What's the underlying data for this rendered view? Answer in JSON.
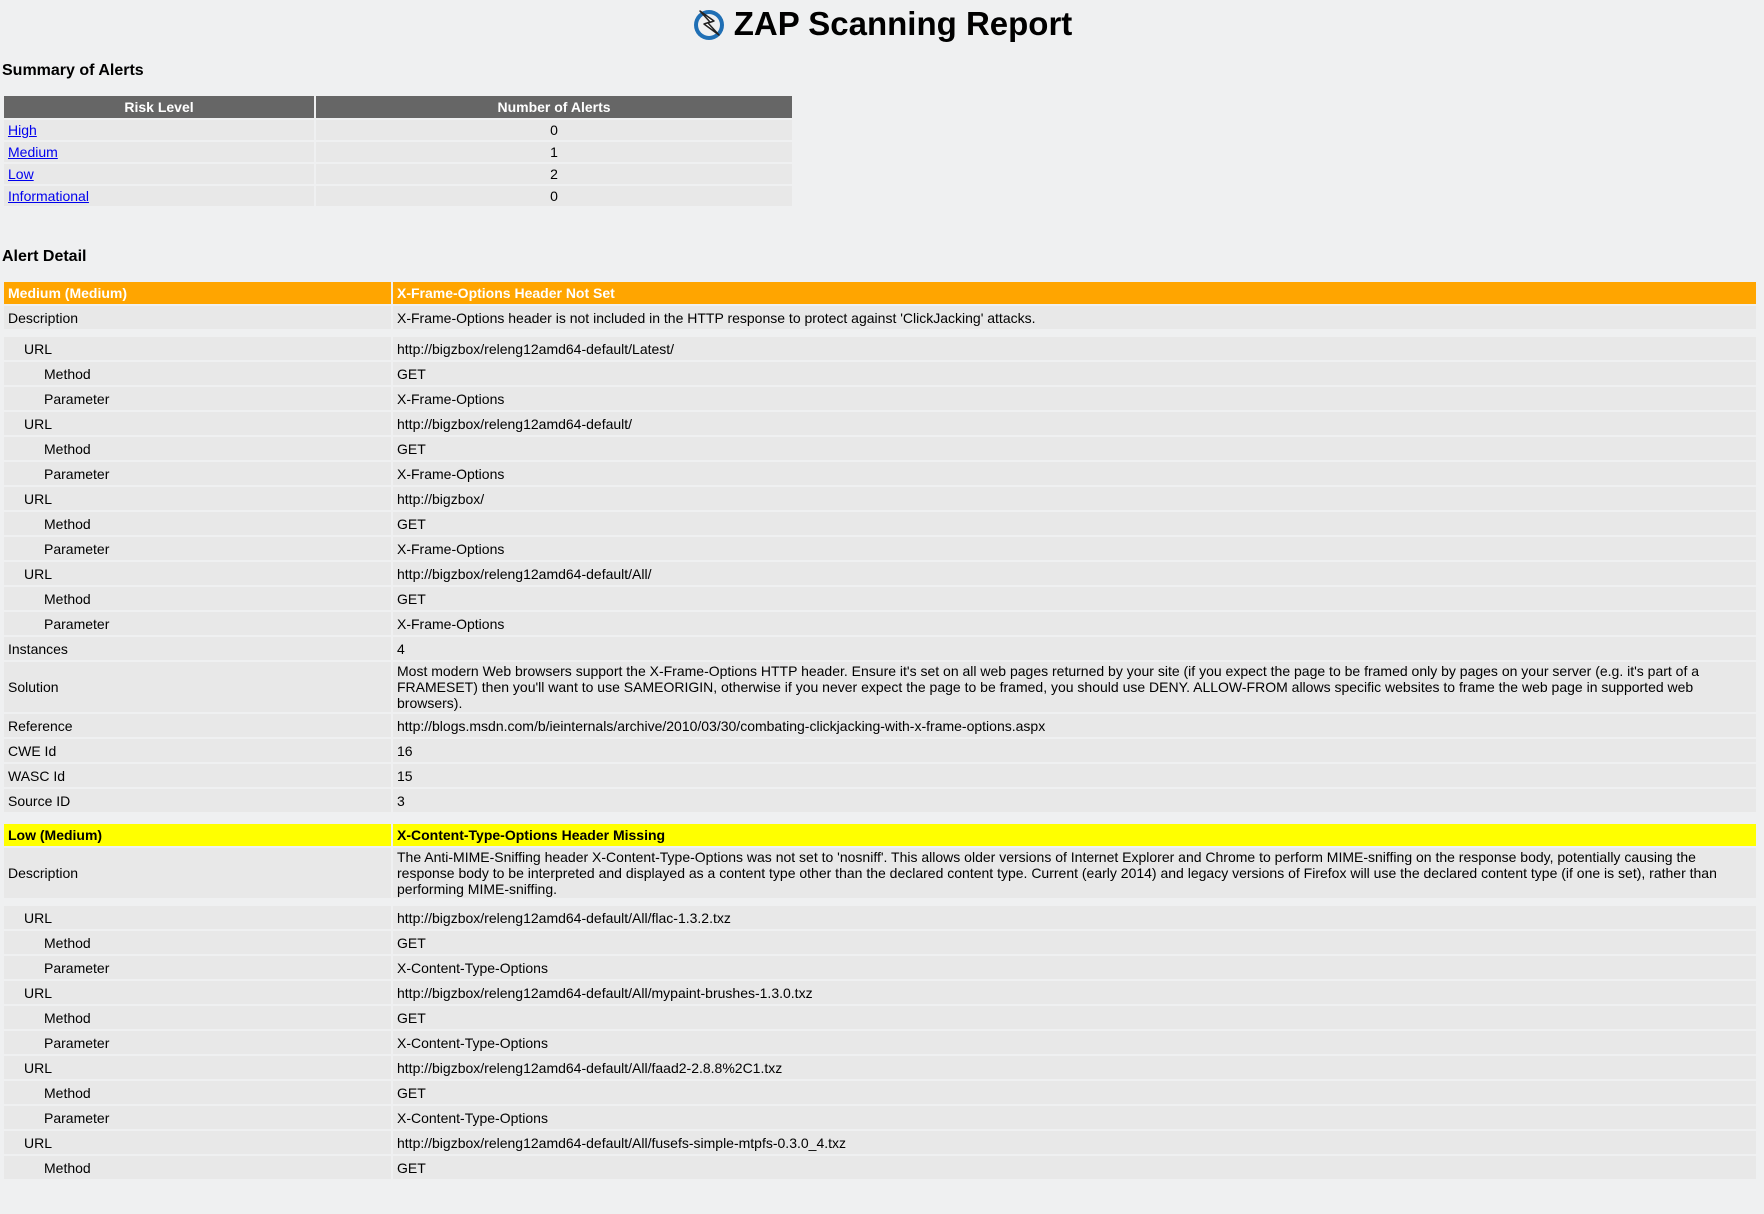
{
  "title": "ZAP Scanning Report",
  "summary": {
    "heading": "Summary of Alerts",
    "col_risk": "Risk Level",
    "col_count": "Number of Alerts",
    "rows": [
      {
        "level": "High",
        "count": "0"
      },
      {
        "level": "Medium",
        "count": "1"
      },
      {
        "level": "Low",
        "count": "2"
      },
      {
        "level": "Informational",
        "count": "0"
      }
    ]
  },
  "detail": {
    "heading": "Alert Detail",
    "alerts": [
      {
        "risk": "Medium (Medium)",
        "name": "X-Frame-Options Header Not Set",
        "description_label": "Description",
        "description": "X-Frame-Options header is not included in the HTTP response to protect against 'ClickJacking' attacks.",
        "url_label": "URL",
        "method_label": "Method",
        "param_label": "Parameter",
        "instances_list": [
          {
            "url": "http://bigzbox/releng12amd64-default/Latest/",
            "method": "GET",
            "param": "X-Frame-Options"
          },
          {
            "url": "http://bigzbox/releng12amd64-default/",
            "method": "GET",
            "param": "X-Frame-Options"
          },
          {
            "url": "http://bigzbox/",
            "method": "GET",
            "param": "X-Frame-Options"
          },
          {
            "url": "http://bigzbox/releng12amd64-default/All/",
            "method": "GET",
            "param": "X-Frame-Options"
          }
        ],
        "instances_label": "Instances",
        "instances": "4",
        "solution_label": "Solution",
        "solution": "Most modern Web browsers support the X-Frame-Options HTTP header. Ensure it's set on all web pages returned by your site (if you expect the page to be framed only by pages on your server (e.g. it's part of a FRAMESET) then you'll want to use SAMEORIGIN, otherwise if you never expect the page to be framed, you should use DENY. ALLOW-FROM allows specific websites to frame the web page in supported web browsers).",
        "reference_label": "Reference",
        "reference": "http://blogs.msdn.com/b/ieinternals/archive/2010/03/30/combating-clickjacking-with-x-frame-options.aspx",
        "cwe_label": "CWE Id",
        "cwe": "16",
        "wasc_label": "WASC Id",
        "wasc": "15",
        "source_label": "Source ID",
        "source": "3"
      },
      {
        "risk": "Low (Medium)",
        "name": "X-Content-Type-Options Header Missing",
        "description_label": "Description",
        "description": "The Anti-MIME-Sniffing header X-Content-Type-Options was not set to 'nosniff'. This allows older versions of Internet Explorer and Chrome to perform MIME-sniffing on the response body, potentially causing the response body to be interpreted and displayed as a content type other than the declared content type. Current (early 2014) and legacy versions of Firefox will use the declared content type (if one is set), rather than performing MIME-sniffing.",
        "url_label": "URL",
        "method_label": "Method",
        "param_label": "Parameter",
        "instances_list": [
          {
            "url": "http://bigzbox/releng12amd64-default/All/flac-1.3.2.txz",
            "method": "GET",
            "param": "X-Content-Type-Options"
          },
          {
            "url": "http://bigzbox/releng12amd64-default/All/mypaint-brushes-1.3.0.txz",
            "method": "GET",
            "param": "X-Content-Type-Options"
          },
          {
            "url": "http://bigzbox/releng12amd64-default/All/faad2-2.8.8%2C1.txz",
            "method": "GET",
            "param": "X-Content-Type-Options"
          },
          {
            "url": "http://bigzbox/releng12amd64-default/All/fusefs-simple-mtpfs-0.3.0_4.txz",
            "method": "GET",
            "param": ""
          }
        ]
      }
    ]
  }
}
